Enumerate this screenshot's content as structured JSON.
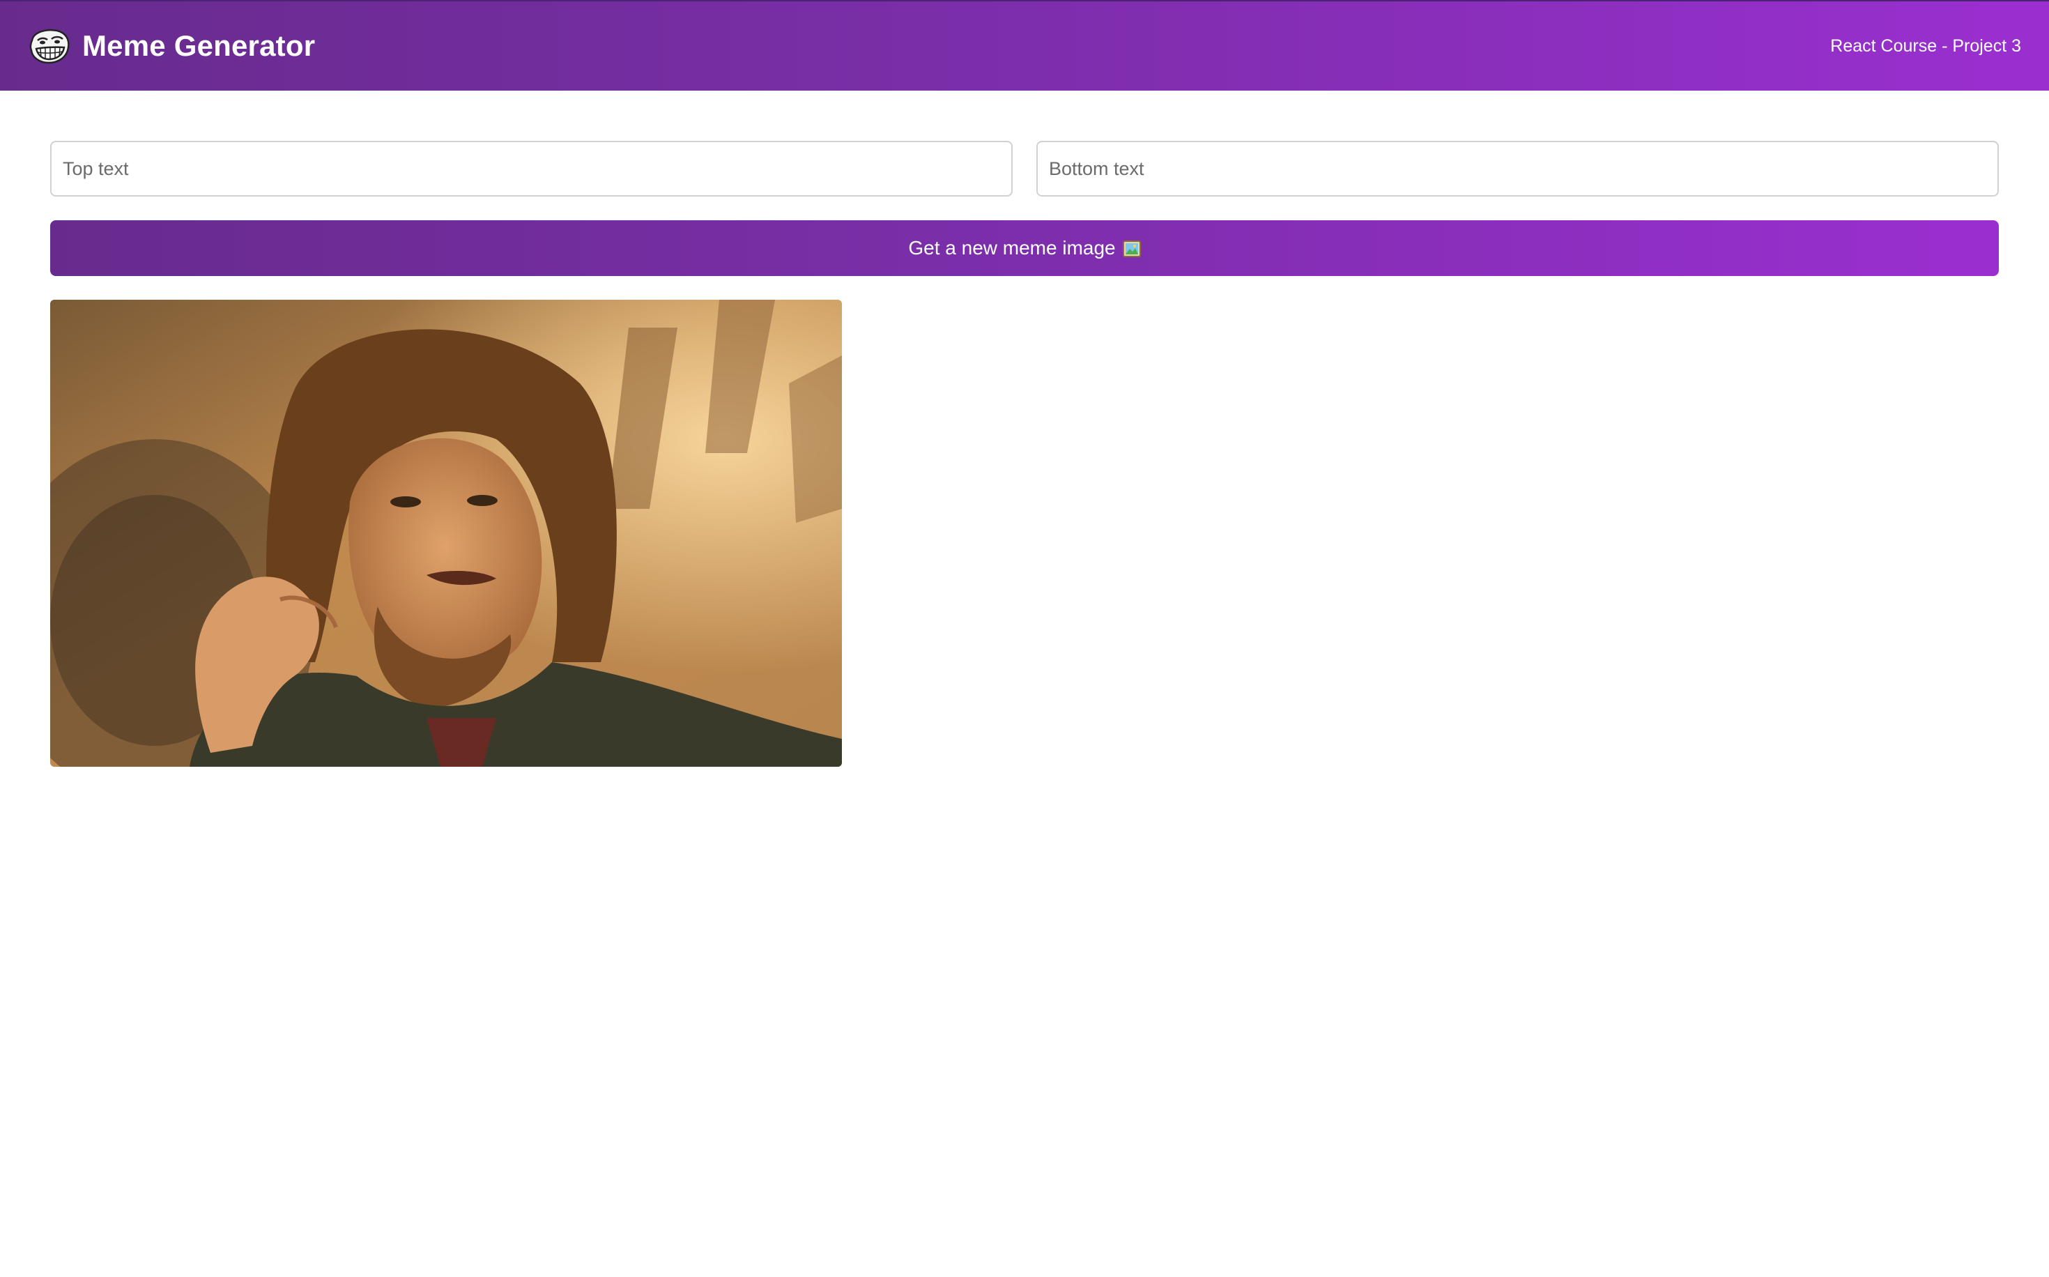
{
  "header": {
    "title": "Meme Generator",
    "subtitle": "React Course - Project 3",
    "logo_icon": "troll-face-icon"
  },
  "form": {
    "top_text": {
      "value": "",
      "placeholder": "Top text"
    },
    "bottom_text": {
      "value": "",
      "placeholder": "Bottom text"
    },
    "button_label": "Get a new meme image",
    "button_icon": "framed-picture-icon"
  },
  "meme": {
    "image_icon": "meme-image"
  },
  "colors": {
    "header_gradient_start": "#672b8d",
    "header_gradient_end": "#9a2fd0",
    "button_gradient_start": "#672b8d",
    "button_gradient_end": "#9a2fd0"
  }
}
